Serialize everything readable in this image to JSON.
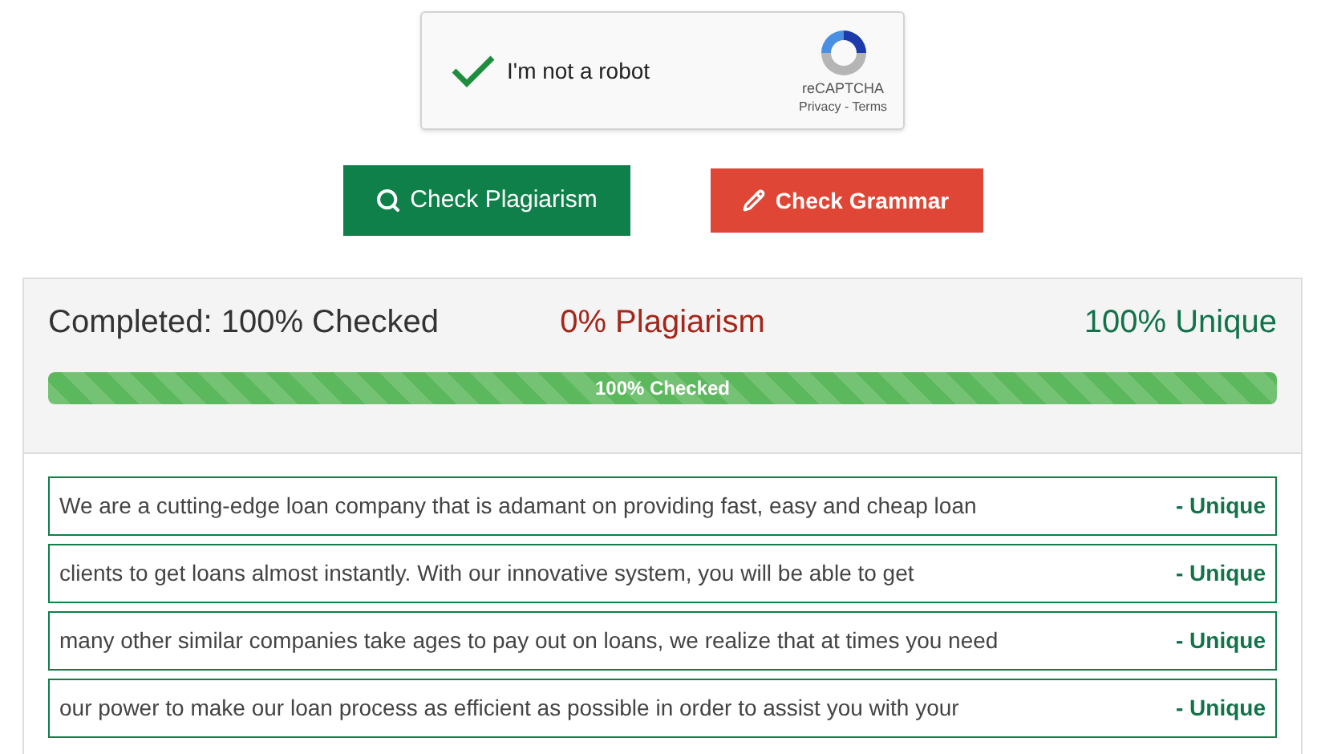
{
  "captcha": {
    "label": "I'm not a robot",
    "checked": true,
    "brand": "reCAPTCHA",
    "links": "Privacy - Terms"
  },
  "buttons": [
    {
      "label": "Check Plagiarism",
      "kind": "search"
    },
    {
      "label": "Check Grammar",
      "kind": "pencil"
    }
  ],
  "summary": {
    "completed": "Completed: 100% Checked",
    "plagiarism": "0% Plagiarism",
    "unique": "100% Unique"
  },
  "progress": {
    "label": "100% Checked",
    "level": 1
  },
  "results": [
    {
      "text": "We are a cutting-edge loan company that is adamant on providing fast, easy and cheap loan",
      "status": "- Unique"
    },
    {
      "text": "clients to get loans almost instantly. With our innovative system, you will be able to get",
      "status": "- Unique"
    },
    {
      "text": "many other similar companies take ages to pay out on loans, we realize that at times you need",
      "status": "- Unique"
    },
    {
      "text": "our power to make our loan process as efficient as possible in order to assist you with your",
      "status": "- Unique"
    }
  ]
}
